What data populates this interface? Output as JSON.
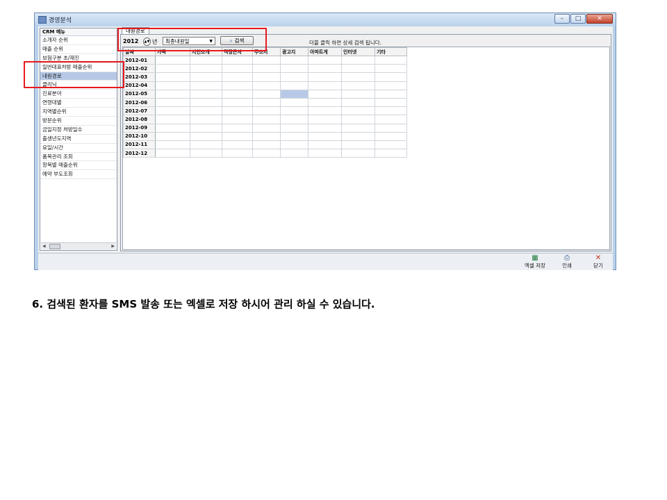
{
  "window": {
    "title": "경영분석",
    "buttons": {
      "minimize": "–",
      "maximize": "□",
      "close": "✕"
    }
  },
  "menu": {
    "header": "CRM 메뉴",
    "items": [
      "소개자 순위",
      "매출 순위",
      "보험구분 초/재진",
      "일반대표처방 매출순위",
      "내원경로",
      "클리닉",
      "진료분야",
      "연령대별",
      "지역별순위",
      "방문순위",
      "금일지정 처방일수",
      "출생년도지역",
      "요일/시간",
      "품목관리 조회",
      "항목별 매출순위",
      "예약 부도조회"
    ],
    "selected_index": 4
  },
  "tab": {
    "label": "내원경로"
  },
  "toolbar": {
    "year": "2012",
    "year_unit": "년",
    "select_value": "최종내원일",
    "search_label": "검색",
    "hint": "더블 클릭 하면 상세 검색 됩니다."
  },
  "grid": {
    "headers": [
      "날짜",
      "가족",
      "지인소개",
      "직장근처",
      "주소지",
      "광고지",
      "아파트게",
      "인터넷",
      "기타"
    ],
    "rows": [
      "2012-01",
      "2012-02",
      "2012-03",
      "2012-04",
      "2012-05",
      "2012-06",
      "2012-07",
      "2012-08",
      "2012-09",
      "2012-10",
      "2012-11",
      "2012-12"
    ],
    "highlight": {
      "row": 4,
      "col": 5
    }
  },
  "statusbar": {
    "excel_label": "엑셀 저장",
    "print_label": "인쇄",
    "close_label": "닫기"
  },
  "icons": {
    "app": "app-icon",
    "search": "search-icon",
    "excel": "excel-icon",
    "print": "printer-icon",
    "close": "close-icon"
  },
  "colors": {
    "highlight_box": "#e8191e",
    "selection": "#b7c8e6"
  },
  "caption": "6. 검색된 환자를 SMS 발송 또는 엑셀로 저장 하시어 관리 하실 수 있습니다."
}
